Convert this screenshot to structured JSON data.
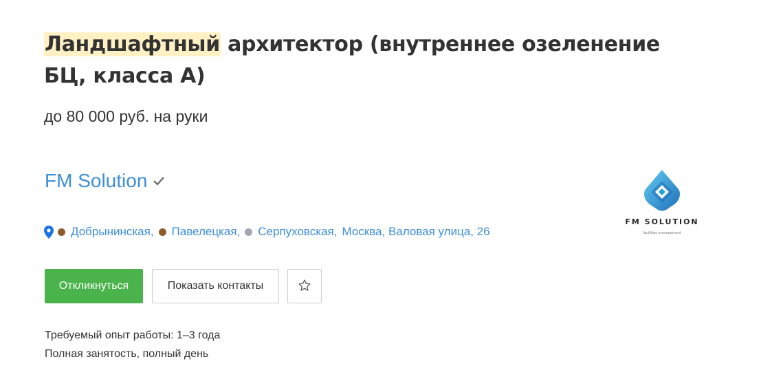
{
  "vacancy": {
    "title_highlight": "Ландшафтный",
    "title_rest": " архитектор (внутреннее озеленение БЦ, класса А)",
    "salary": "до 80 000 руб. на руки"
  },
  "company": {
    "name": "FM Solution",
    "verified_icon": "check-icon",
    "logo": {
      "brand": "FM SOLUTION",
      "tagline": "facilities management",
      "colors": {
        "primary": "#1aa3e0",
        "dark": "#1f6fb8",
        "light": "#62cdf3"
      }
    }
  },
  "address": {
    "pin_icon": "map-pin-icon",
    "pin_color": "#1a73e8",
    "stations": [
      {
        "name": "Добрынинская,",
        "color": "#8d5b2d"
      },
      {
        "name": "Павелецкая,",
        "color": "#8d5b2d"
      },
      {
        "name": "Серпуховская,",
        "color": "#a2a5b4"
      }
    ],
    "location": "Москва, Валовая улица, 26"
  },
  "actions": {
    "apply_label": "Откликнуться",
    "apply_color": "#4bb34b",
    "contacts_label": "Показать контакты",
    "favorite_icon": "star-outline-icon"
  },
  "details": {
    "experience": "Требуемый опыт работы: 1–3 года",
    "employment": "Полная занятость, полный день"
  }
}
